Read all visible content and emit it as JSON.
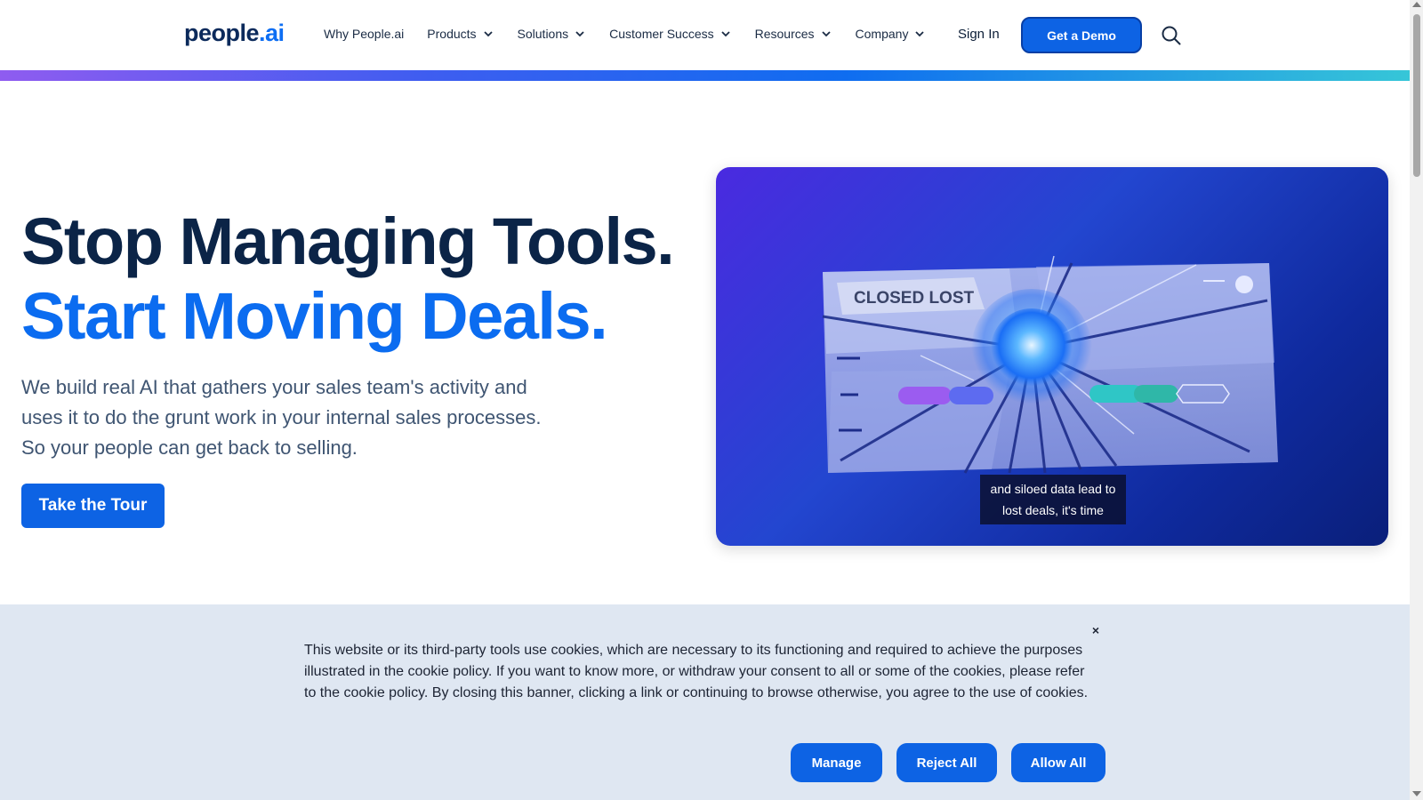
{
  "header": {
    "logo_text": "people",
    "logo_suffix": ".ai",
    "nav": [
      {
        "label": "Why People.ai",
        "has_dropdown": false
      },
      {
        "label": "Products",
        "has_dropdown": true
      },
      {
        "label": "Solutions",
        "has_dropdown": true
      },
      {
        "label": "Customer Success",
        "has_dropdown": true
      },
      {
        "label": "Resources",
        "has_dropdown": true
      },
      {
        "label": "Company",
        "has_dropdown": true
      }
    ],
    "sign_in": "Sign In",
    "demo_button": "Get a Demo",
    "search_icon": "search-icon"
  },
  "hero": {
    "headline_line1": "Stop Managing Tools.",
    "headline_line2": "Start Moving Deals.",
    "description": "We build real AI that gathers your sales team's activity and uses it to do the grunt work in your internal sales processes. So your people can get back to selling.",
    "cta": "Take the Tour",
    "media_badge": "CLOSED LOST",
    "media_caption": "and siloed data lead to lost deals, it's time"
  },
  "cookie_banner": {
    "text": "This website or its third-party tools use cookies, which are necessary to its functioning and required to achieve the purposes illustrated in the cookie policy. If you want to know more, or withdraw your consent to all or some of the cookies, please refer to the cookie policy. By closing this banner, clicking a link or continuing to browse otherwise, you agree to the use of cookies.",
    "close": "×",
    "manage": "Manage",
    "reject_all": "Reject All",
    "allow_all": "Allow All"
  },
  "colors": {
    "brand_blue": "#0d63e4",
    "headline_dark": "#0b2447",
    "headline_blue": "#0b6cf0"
  }
}
